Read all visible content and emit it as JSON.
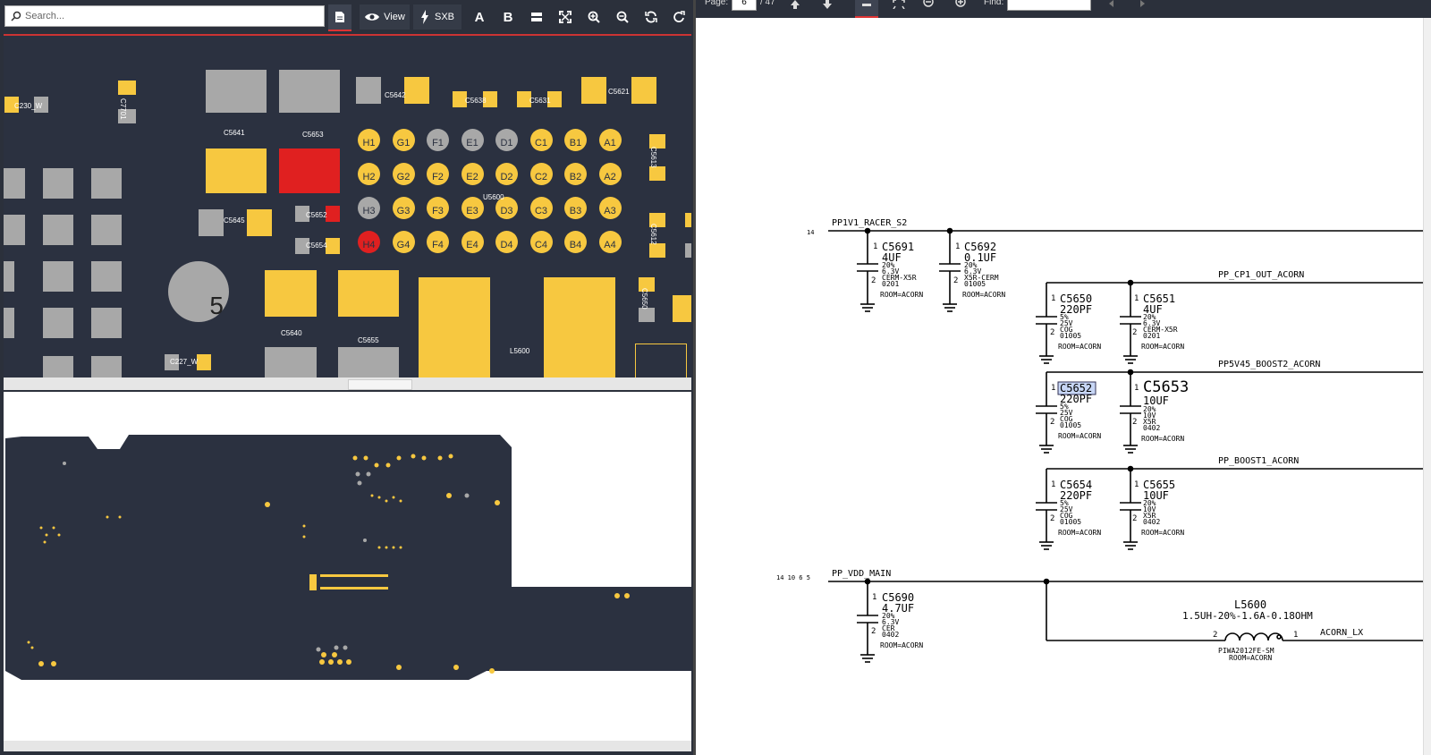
{
  "search": {
    "placeholder": "Search..."
  },
  "toolbar": {
    "view_label": "View",
    "sxb_label": "SXB",
    "a_label": "A",
    "b_label": "B"
  },
  "board": {
    "labels": {
      "c230": "C230_W",
      "c7701": "C7701",
      "c5641": "C5641",
      "c5653": "C5653",
      "c5642": "C5642",
      "c5638": "C5638",
      "c5631": "C5631",
      "c5621": "C5621",
      "c5645": "C5645",
      "c5652": "C5652",
      "c5654": "C5654",
      "u5600": "U5600",
      "c5613": "C5613",
      "c5612": "C5612",
      "c5640": "C5640",
      "c5655": "C5655",
      "l5600": "L5600",
      "c227": "C227_W",
      "c5650": "C5650",
      "mark": "5"
    },
    "balls": [
      [
        "H1",
        "G1",
        "F1",
        "E1",
        "D1",
        "C1",
        "B1",
        "A1"
      ],
      [
        "H2",
        "G2",
        "F2",
        "E2",
        "D2",
        "C2",
        "B2",
        "A2"
      ],
      [
        "H3",
        "G3",
        "F3",
        "E3",
        "D3",
        "C3",
        "B3",
        "A3"
      ],
      [
        "H4",
        "G4",
        "F4",
        "E4",
        "D4",
        "C4",
        "B4",
        "A4"
      ]
    ]
  },
  "pdf": {
    "page_label": "Page:",
    "page": "6",
    "total": "/ 47",
    "find_label": "Find:"
  },
  "schematic": {
    "net_racer": "PP1V1_RACER_S2",
    "net_racer_ref": "14",
    "net_cp1": "PP_CP1_OUT_ACORN",
    "net_boost2": "PP5V45_BOOST2_ACORN",
    "net_boost1": "PP_BOOST1_ACORN",
    "net_vdd": "PP_VDD_MAIN",
    "net_vdd_ref": "14 10 6 5",
    "net_lx": "ACORN_LX",
    "pin1": "1",
    "pin2": "2",
    "caps": {
      "c5691": {
        "ref": "C5691",
        "val": "4UF",
        "l1": "20%",
        "l2": "6.3V",
        "l3": "CERM-X5R",
        "l4": "0201",
        "room": "ROOM=ACORN"
      },
      "c5692": {
        "ref": "C5692",
        "val": "0.1UF",
        "l1": "20%",
        "l2": "6.3V",
        "l3": "X5R-CERM",
        "l4": "01005",
        "room": "ROOM=ACORN"
      },
      "c5650": {
        "ref": "C5650",
        "val": "220PF",
        "l1": "5%",
        "l2": "25V",
        "l3": "COG",
        "l4": "01005",
        "room": "ROOM=ACORN"
      },
      "c5651": {
        "ref": "C5651",
        "val": "4UF",
        "l1": "20%",
        "l2": "6.3V",
        "l3": "CERM-X5R",
        "l4": "0201",
        "room": "ROOM=ACORN"
      },
      "c5652": {
        "ref": "C5652",
        "val": "220PF",
        "l1": "5%",
        "l2": "25V",
        "l3": "COG",
        "l4": "01005",
        "room": "ROOM=ACORN"
      },
      "c5653": {
        "ref": "C5653",
        "val": "10UF",
        "l1": "20%",
        "l2": "10V",
        "l3": "X5R",
        "l4": "0402",
        "room": "ROOM=ACORN"
      },
      "c5654": {
        "ref": "C5654",
        "val": "220PF",
        "l1": "5%",
        "l2": "25V",
        "l3": "COG",
        "l4": "01005",
        "room": "ROOM=ACORN"
      },
      "c5655": {
        "ref": "C5655",
        "val": "10UF",
        "l1": "20%",
        "l2": "10V",
        "l3": "X5R",
        "l4": "0402",
        "room": "ROOM=ACORN"
      },
      "c5690": {
        "ref": "C5690",
        "val": "4.7UF",
        "l1": "20%",
        "l2": "6.3V",
        "l3": "CER",
        "l4": "0402",
        "room": "ROOM=ACORN"
      }
    },
    "l5600": {
      "ref": "L5600",
      "val": "1.5UH-20%-1.6A-0.18OHM",
      "pkg": "PIWA2012FE-SM",
      "room": "ROOM=ACORN"
    }
  },
  "colors": {
    "pad_yellow": "#f7c840",
    "pad_gray": "#a8a8a8",
    "pad_red": "#e02020",
    "board_bg": "#2b3140",
    "highlight": "#c7d6f5"
  }
}
